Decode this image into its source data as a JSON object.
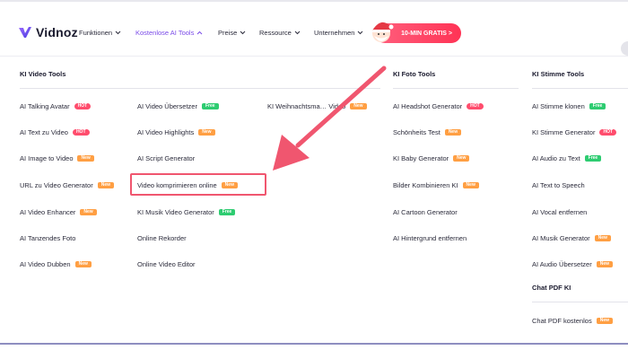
{
  "brand": {
    "name": "Vidnoz"
  },
  "nav": {
    "items": [
      {
        "label": "Funktionen",
        "active": false
      },
      {
        "label": "Kostenlose AI Tools",
        "active": true
      },
      {
        "label": "Preise",
        "active": false
      },
      {
        "label": "Ressource",
        "active": false
      },
      {
        "label": "Unternehmen",
        "active": false
      }
    ],
    "promo": "10-MIN GRATIS >"
  },
  "columns": {
    "video": {
      "title": "KI Video Tools",
      "col1": [
        {
          "label": "AI Talking Avatar",
          "badge": "HOT",
          "type": "hot"
        },
        {
          "label": "AI Text zu Video",
          "badge": "HOT",
          "type": "hot"
        },
        {
          "label": "AI Image to Video",
          "badge": "New",
          "type": "new"
        },
        {
          "label": "URL zu Video Generator",
          "badge": "New",
          "type": "new"
        },
        {
          "label": "AI Video Enhancer",
          "badge": "New",
          "type": "new"
        },
        {
          "label": "AI Tanzendes Foto",
          "badge": "",
          "type": ""
        },
        {
          "label": "AI Video Dubben",
          "badge": "New",
          "type": "new"
        }
      ],
      "col2": [
        {
          "label": "AI Video Übersetzer",
          "badge": "Free",
          "type": "free"
        },
        {
          "label": "AI Video Highlights",
          "badge": "New",
          "type": "new"
        },
        {
          "label": "AI Script Generator",
          "badge": "",
          "type": ""
        },
        {
          "label": "Video komprimieren online",
          "badge": "New",
          "type": "new"
        },
        {
          "label": "KI Musik Video Generator",
          "badge": "Free",
          "type": "free"
        },
        {
          "label": "Online Rekorder",
          "badge": "",
          "type": ""
        },
        {
          "label": "Online Video Editor",
          "badge": "",
          "type": ""
        }
      ],
      "col3": [
        {
          "label": "KI Weihnachtsma… Video",
          "badge": "New",
          "type": "new"
        }
      ]
    },
    "foto": {
      "title": "KI Foto Tools",
      "items": [
        {
          "label": "AI Headshot Generator",
          "badge": "HOT",
          "type": "hot"
        },
        {
          "label": "Schönheits Test",
          "badge": "New",
          "type": "new"
        },
        {
          "label": "KI Baby Generator",
          "badge": "New",
          "type": "new"
        },
        {
          "label": "Bilder Kombinieren KI",
          "badge": "New",
          "type": "new"
        },
        {
          "label": "AI Cartoon Generator",
          "badge": "",
          "type": ""
        },
        {
          "label": "AI Hintergrund entfernen",
          "badge": "",
          "type": ""
        }
      ]
    },
    "stimme": {
      "title": "KI Stimme Tools",
      "items": [
        {
          "label": "AI Stimme klonen",
          "badge": "Free",
          "type": "free"
        },
        {
          "label": "KI Stimme Generator",
          "badge": "HOT",
          "type": "hot"
        },
        {
          "label": "AI Audio zu Text",
          "badge": "Free",
          "type": "free"
        },
        {
          "label": "AI Text to Speech",
          "badge": "",
          "type": ""
        },
        {
          "label": "AI Vocal entfernen",
          "badge": "",
          "type": ""
        },
        {
          "label": "AI Musik Generator",
          "badge": "New",
          "type": "new"
        },
        {
          "label": "AI Audio Übersetzer",
          "badge": "New",
          "type": "new"
        }
      ],
      "chatpdf_title": "Chat PDF KI",
      "chatpdf_items": [
        {
          "label": "Chat PDF kostenlos",
          "badge": "New",
          "type": "new"
        }
      ]
    }
  },
  "colors": {
    "accent": "#7b4ce8",
    "highlight": "#f0566f",
    "hot": "#ff4d6d",
    "new": "#ff9f43",
    "free": "#2ecc71"
  }
}
